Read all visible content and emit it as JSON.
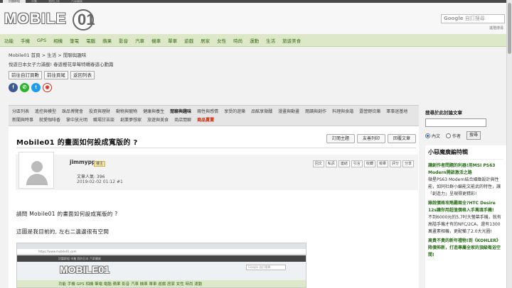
{
  "top_tabs": [
    "討論群組",
    "市集",
    "我的日本",
    "汽車購買"
  ],
  "logo_text": "MOBILE",
  "logo_digit": "01",
  "search": {
    "google": "Google",
    "placeholder": "自訂搜尋",
    "advanced": "進階搜尋"
  },
  "nav": [
    "功能",
    "手機",
    "GPS",
    "相機",
    "筆電",
    "電腦",
    "蘋果",
    "影音",
    "汽車",
    "機車",
    "單車",
    "遊戲",
    "居家",
    "女性",
    "時尚",
    "運動",
    "生活",
    "旅遊美食"
  ],
  "breadcrumb": "Mobile01 首頁 > 生活 > 閒聊與趣味",
  "subtitle": "悅遊日本女子力滿載! 春遊櫻花草莓特輯春遊心動篇",
  "buttons": {
    "prev_page": "前往自訂頁數",
    "first_page": "前往頁尾",
    "back_list": "返回列表"
  },
  "categories": [
    "分區列表",
    "遙控與模型",
    "珠品博覽會",
    "投資與理財",
    "動物與寵物",
    "健康與養生",
    "閒聊與趣味",
    "兩性與感情",
    "享受的遊樂",
    "品酩享微醺",
    "漫畫與動畫",
    "閱讀與創作",
    "料理與食譜",
    "露營野炊樂",
    "軍事迷基地",
    "新聞與時事",
    "就愛咖啡香",
    "掌中放光明",
    "職場甘苦談",
    "創業夢想家",
    "旅遊與美食",
    "商店閒聊",
    "商品賣賣"
  ],
  "post": {
    "title": "Mobile01 的畫面如何設成寬版的 ?",
    "actions": [
      "訂閱主題",
      "友善列印",
      "回覆文章"
    ],
    "username": "jimmypp",
    "role": "樓主",
    "popularity": "文章人氣: 396",
    "datetime": "2019-02-02 01:12  #1",
    "user_buttons": [
      "回文",
      "私訊",
      "連結",
      "引言",
      "收藏",
      "檢舉",
      "評分",
      "分享"
    ],
    "line1": "請問 Mobile01 的畫面如何設成寬版的 ?",
    "line2": "這圖是我目前的, 左右二邊邊很有空間"
  },
  "screenshot": {
    "url": "https://www.mobile01.com",
    "top": "討論群組  市集  我的日本  汽車購買",
    "logo": "MOBILE01",
    "search": "Google 自訂搜尋",
    "nav": "功能  手機  GPS  相機  筆電  電腦  蘋果  影音  汽車  機車  單車  遊戲  居家  女性  時尚  運動"
  },
  "right": {
    "search_title": "搜尋於此討論文章",
    "radio_content": "內文",
    "radio_author": "作者",
    "search_btn": "搜尋",
    "box_title": "小惡魔廣編特輯",
    "items": [
      {
        "title": "讓創作者問題的利器!用MSI PS63 Modern開啟激活之路",
        "desc": "微星PS63 Modern結合細緻設計與性能，如同社群小編能文能武的特性，讓「創造力」呈現得更精彩!"
      },
      {
        "title": "錄說價格攻略霸兩全?HTC Desire 12s讓你用超值價格入手萬填手機!",
        "desc": "不到6000元的5.7吋大螢幕手機，就有高階手機才有的NFC/2CA，還有1300萬畫素相機，更配備了2.0大光圈!"
      },
      {
        "title": "高貴不貴的新年禮物!到《KOHLER》降價佈新，打造專屬全家的頂級衛浴空間!",
        "desc": ""
      }
    ]
  }
}
